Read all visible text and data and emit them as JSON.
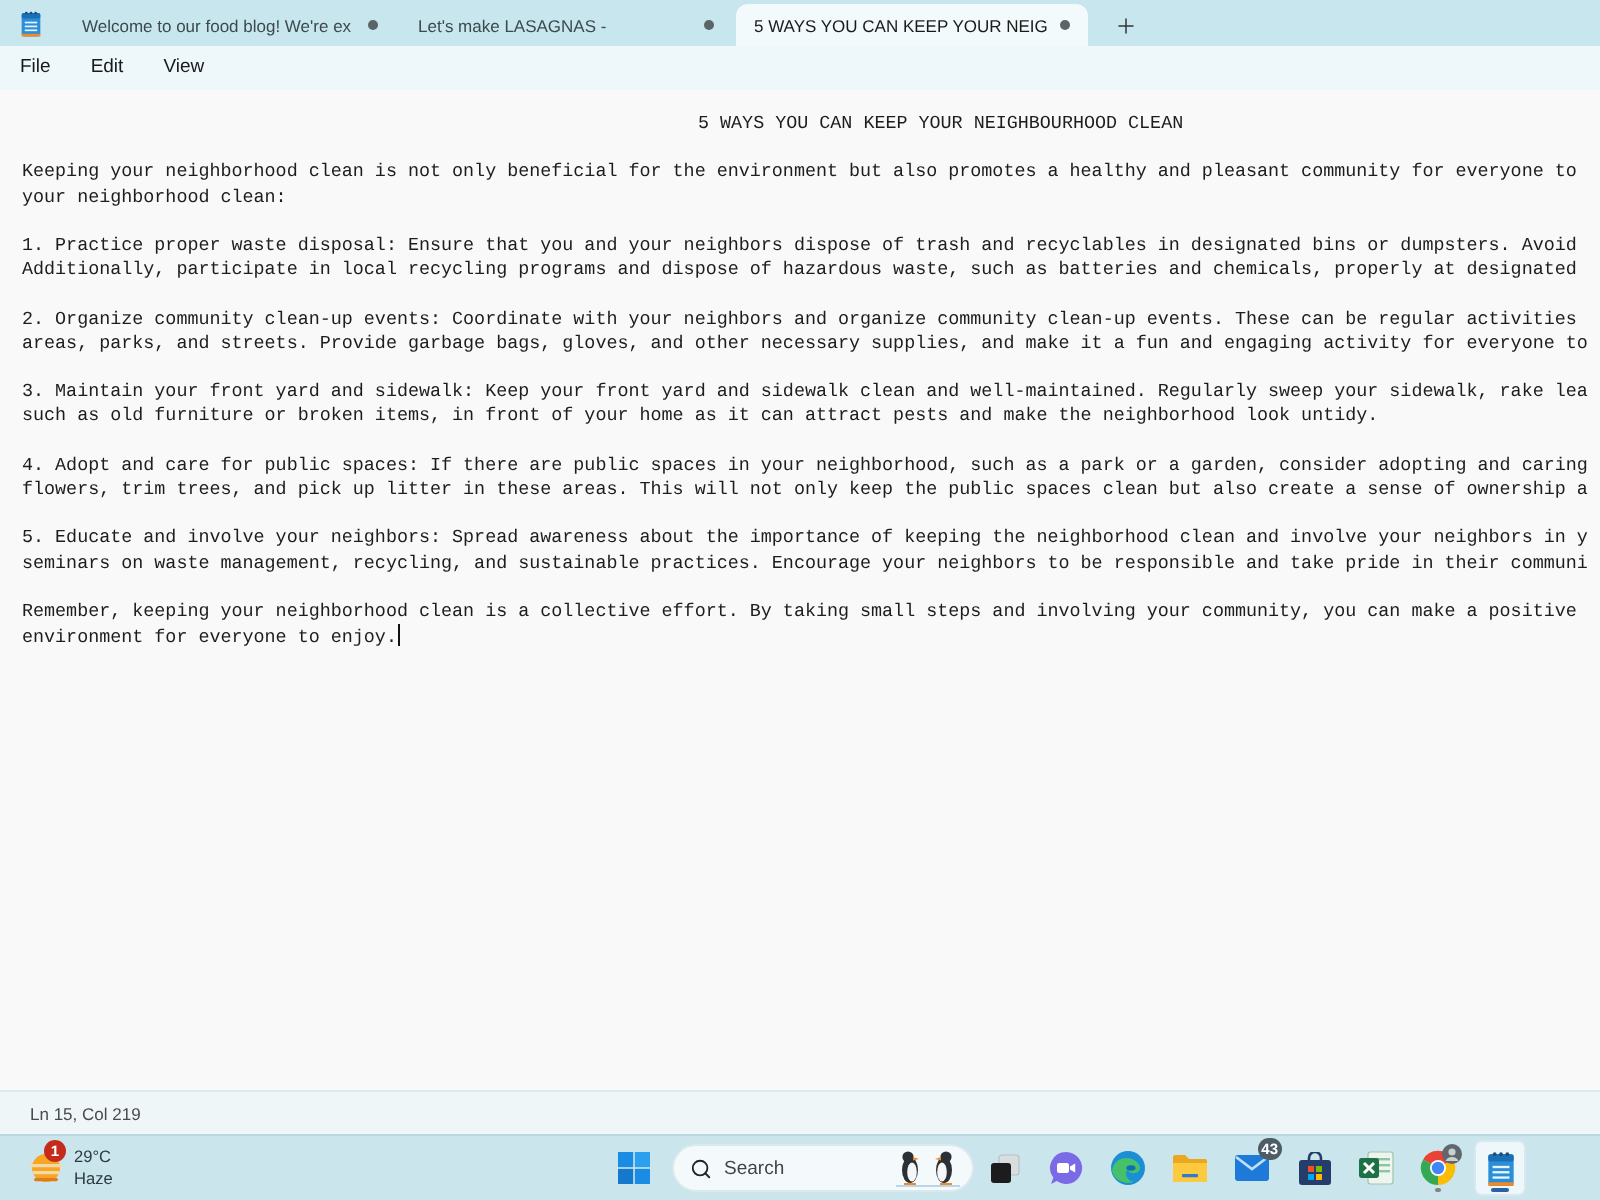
{
  "tabs": [
    {
      "title": "Welcome to our food blog! We're ex",
      "modified": true,
      "selected": false
    },
    {
      "title": "Let's make LASAGNAS -",
      "modified": true,
      "selected": false
    },
    {
      "title": "5 WAYS YOU CAN KEEP YOUR NEIG",
      "modified": true,
      "selected": true
    }
  ],
  "menu": [
    "File",
    "Edit",
    "View"
  ],
  "document": {
    "caret_visible": true,
    "paragraphs": [
      {
        "kind": "heading",
        "lines": [
          "5 WAYS YOU CAN KEEP YOUR NEIGHBOURHOOD CLEAN"
        ]
      },
      {
        "kind": "body",
        "lines": [
          "Keeping your neighborhood clean is not only beneficial for the environment but also promotes a healthy and pleasant community for everyone to",
          "your neighborhood clean:"
        ]
      },
      {
        "kind": "body",
        "lines": [
          "1. Practice proper waste disposal: Ensure that you and your neighbors dispose of trash and recyclables in designated bins or dumpsters. Avoid",
          "Additionally, participate in local recycling programs and dispose of hazardous waste, such as batteries and chemicals, properly at designated"
        ]
      },
      {
        "kind": "body",
        "lines": [
          "2. Organize community clean-up events: Coordinate with your neighbors and organize community clean-up events. These can be regular activities",
          "areas, parks, and streets. Provide garbage bags, gloves, and other necessary supplies, and make it a fun and engaging activity for everyone to"
        ]
      },
      {
        "kind": "body",
        "lines": [
          "3. Maintain your front yard and sidewalk: Keep your front yard and sidewalk clean and well-maintained. Regularly sweep your sidewalk, rake lea",
          "such as old furniture or broken items, in front of your home as it can attract pests and make the neighborhood look untidy."
        ]
      },
      {
        "kind": "body",
        "lines": [
          "4. Adopt and care for public spaces: If there are public spaces in your neighborhood, such as a park or a garden, consider adopting and caring",
          "flowers, trim trees, and pick up litter in these areas. This will not only keep the public spaces clean but also create a sense of ownership a"
        ]
      },
      {
        "kind": "body",
        "lines": [
          "5. Educate and involve your neighbors: Spread awareness about the importance of keeping the neighborhood clean and involve your neighbors in y",
          "seminars on waste management, recycling, and sustainable practices. Encourage your neighbors to be responsible and take pride in their communi"
        ]
      },
      {
        "kind": "body",
        "lines": [
          "Remember, keeping your neighborhood clean is a collective effort. By taking small steps and involving your community, you can make a positive",
          "environment for everyone to enjoy."
        ]
      }
    ]
  },
  "status_bar": {
    "position": "Ln 15, Col 219"
  },
  "taskbar": {
    "weather": {
      "temperature": "29°C",
      "condition": "Haze",
      "badge": "1"
    },
    "search": {
      "label": "Search"
    },
    "apps": [
      {
        "kind": "task-view",
        "selected": false,
        "running": false
      },
      {
        "kind": "chat",
        "selected": false,
        "running": false
      },
      {
        "kind": "edge",
        "selected": false,
        "running": false
      },
      {
        "kind": "folder",
        "selected": false,
        "running": false
      },
      {
        "kind": "mail",
        "badge": "43",
        "selected": false,
        "running": false
      },
      {
        "kind": "store",
        "selected": false,
        "running": false
      },
      {
        "kind": "excel",
        "selected": false,
        "running": false
      },
      {
        "kind": "chrome",
        "selected": false,
        "running": true
      },
      {
        "kind": "notepad",
        "selected": true,
        "running": true
      }
    ]
  }
}
